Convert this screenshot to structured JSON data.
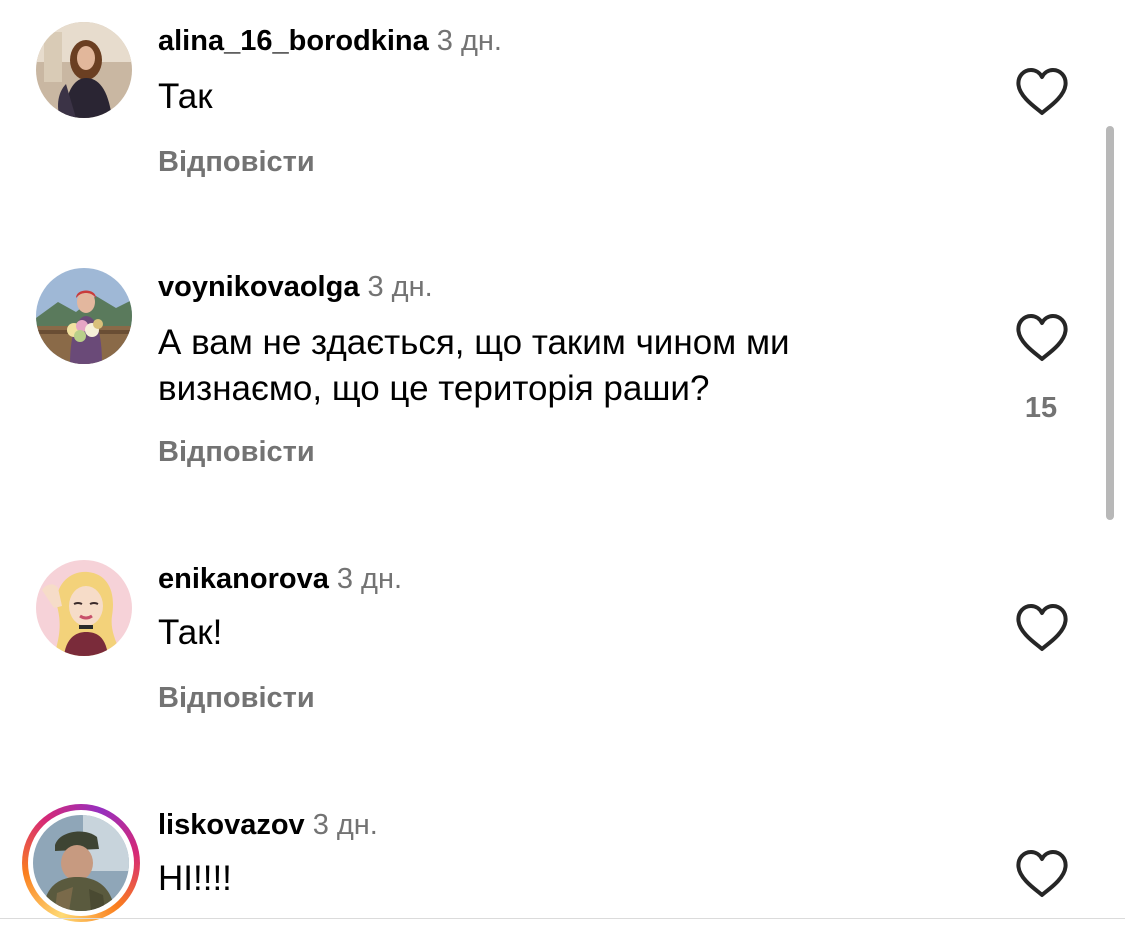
{
  "comments": [
    {
      "username": "alina_16_borodkina",
      "time": "3 дн.",
      "text": "Так",
      "reply_label": "Відповісти",
      "likes": ""
    },
    {
      "username": "voynikovaolga",
      "time": "3 дн.",
      "text": "А вам не здається, що таким чином ми визнаємо, що це територія раши?",
      "reply_label": "Відповісти",
      "likes": "15"
    },
    {
      "username": "enikanorova",
      "time": "3 дн.",
      "text": "Так!",
      "reply_label": "Відповісти",
      "likes": ""
    },
    {
      "username": "liskovazov",
      "time": "3 дн.",
      "text": "НІ!!!!",
      "reply_label": "",
      "likes": ""
    }
  ],
  "colors": {
    "secondary_text": "#737373",
    "primary_text": "#000000",
    "story_ring": "#d62976"
  },
  "icons": {
    "like": "heart-outline-icon"
  }
}
